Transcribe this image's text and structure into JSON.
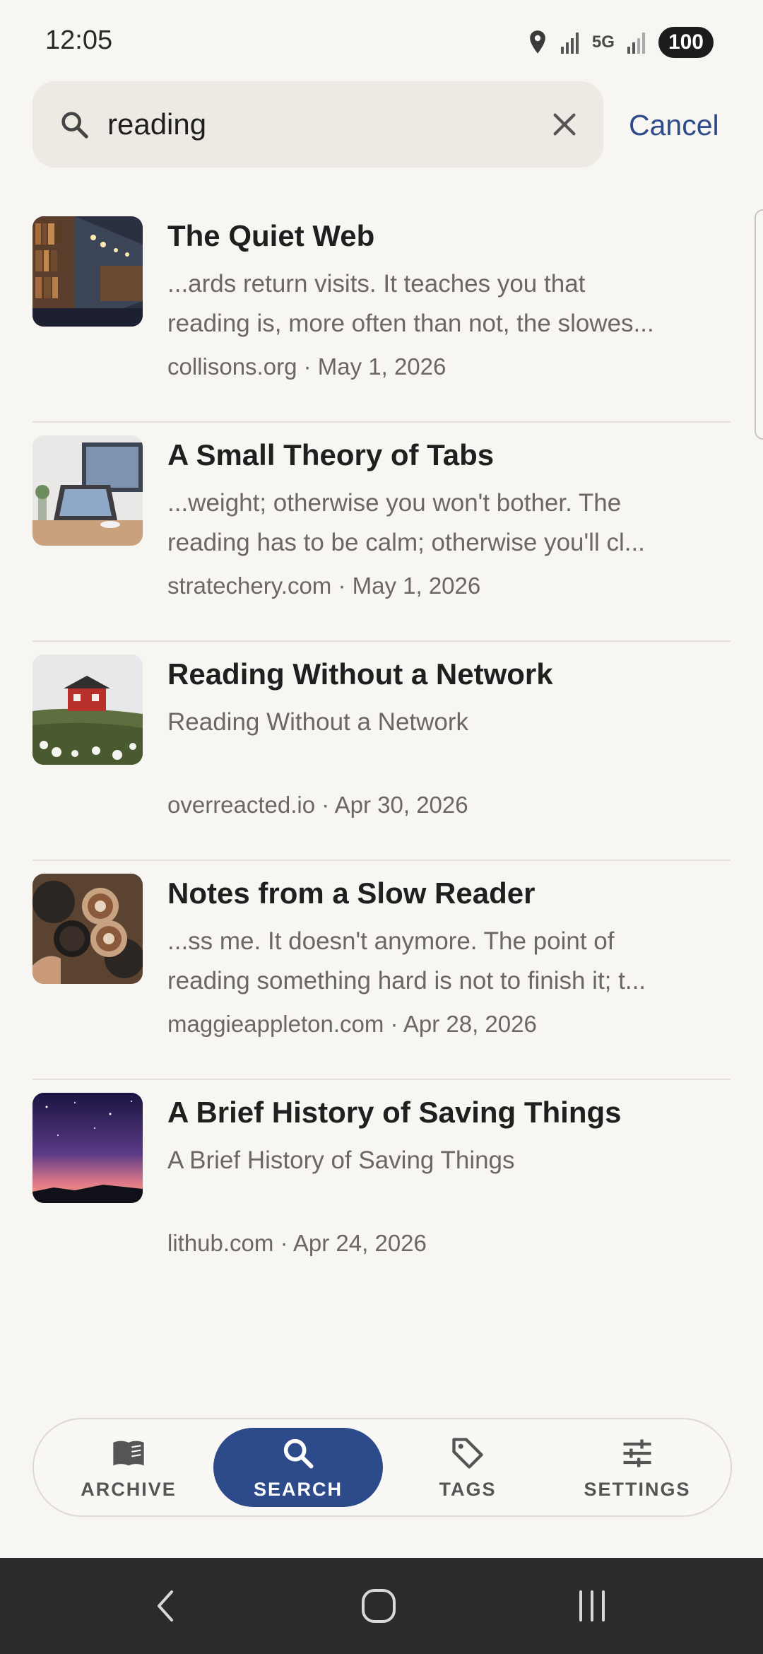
{
  "status_bar": {
    "time": "12:05",
    "network": "5G",
    "battery": "100"
  },
  "search": {
    "query": "reading",
    "cancel_label": "Cancel"
  },
  "results": [
    {
      "title": "The Quiet Web",
      "snippet_line1": "...ards return visits. It teaches you that",
      "snippet_line2": "reading is, more often than not, the slowes...",
      "meta": "collisons.org · May 1, 2026",
      "thumb": "library-bookshelves-image"
    },
    {
      "title": "A Small Theory of Tabs",
      "snippet_line1": "...weight; otherwise you won't bother. The",
      "snippet_line2": "reading has to be calm; otherwise you'll cl...",
      "meta": "stratechery.com · May 1, 2026",
      "thumb": "desk-laptop-image"
    },
    {
      "title": "Reading Without a Network",
      "snippet_line1": "Reading Without a Network",
      "snippet_line2": "",
      "meta": "overreacted.io · Apr 30, 2026",
      "thumb": "red-cabin-image"
    },
    {
      "title": "Notes from a Slow Reader",
      "snippet_line1": "...ss me. It doesn't anymore. The point of",
      "snippet_line2": "reading something hard is not to finish it; t...",
      "meta": "maggieappleton.com · Apr 28, 2026",
      "thumb": "coffee-cups-image"
    },
    {
      "title": "A Brief History of Saving Things",
      "snippet_line1": "A Brief History of Saving Things",
      "snippet_line2": "",
      "meta": "lithub.com · Apr 24, 2026",
      "thumb": "night-sky-image"
    }
  ],
  "bottom_nav": {
    "items": [
      {
        "label": "ARCHIVE",
        "icon": "book-icon"
      },
      {
        "label": "SEARCH",
        "icon": "search-icon",
        "active": true
      },
      {
        "label": "TAGS",
        "icon": "tag-icon"
      },
      {
        "label": "SETTINGS",
        "icon": "sliders-icon"
      }
    ]
  },
  "colors": {
    "accent": "#2d4a8a",
    "background": "#f7f6f2",
    "search_bg": "#ede9e3"
  }
}
